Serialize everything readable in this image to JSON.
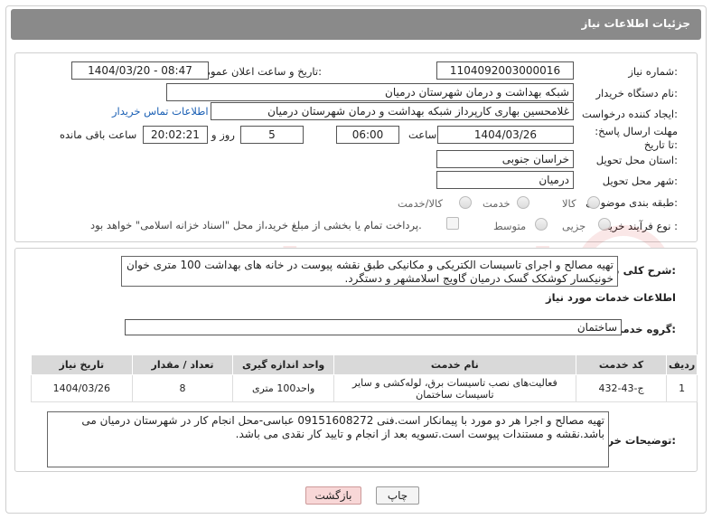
{
  "header": {
    "title": "جزئیات اطلاعات نیاز"
  },
  "form": {
    "need_number_label": "شماره نیاز:",
    "need_number": "1104092003000016",
    "announce_label": "تاریخ و ساعت اعلان عمومی:",
    "announce_value": "1404/03/20 - 08:47",
    "buyer_org_label": "نام دستگاه خریدار:",
    "buyer_org": "شبکه بهداشت و درمان شهرستان درمیان",
    "creator_label": "ایجاد کننده درخواست:",
    "creator": "غلامحسین بهاری کارپرداز شبکه بهداشت و درمان شهرستان درمیان",
    "contact_link": "اطلاعات تماس خریدار",
    "deadline_label": "مهلت ارسال پاسخ: تا تاریخ:",
    "deadline_date": "1404/03/26",
    "time_label": "ساعت",
    "deadline_time": "06:00",
    "days_value": "5",
    "days_label": "روز و",
    "remaining_time": "20:02:21",
    "remaining_label": "ساعت باقی مانده",
    "province_label": "استان محل تحویل:",
    "province": "خراسان جنوبی",
    "city_label": "شهر محل تحویل:",
    "city": "درمیان",
    "category_label": "طبقه بندی موضوعی:",
    "category_options": [
      "کالا",
      "خدمت",
      "کالا/خدمت"
    ],
    "process_label": "نوع فرآیند خرید :",
    "process_options": [
      "جزیی",
      "متوسط"
    ],
    "payment_note": "پرداخت تمام یا بخشی از مبلغ خرید،از محل \"اسناد خزانه اسلامی\" خواهد بود."
  },
  "description": {
    "label": "شرح کلی نیاز:",
    "text": "تهیه مصالح و اجرای تاسیسات الکتریکی و مکانیکی طبق نقشه پیوست در خانه های بهداشت 100 متری خوان خونیکسار کوشکک گسک درمیان گاویج اسلامشهر و دستگرد."
  },
  "services": {
    "section_title": "اطلاعات خدمات مورد نیاز",
    "group_label": "گروه خدمت:",
    "group_value": "ساختمان",
    "columns": [
      "ردیف",
      "کد خدمت",
      "نام خدمت",
      "واحد اندازه گیری",
      "تعداد / مقدار",
      "تاریخ نیاز"
    ],
    "rows": [
      {
        "row": "1",
        "code": "ج-43-432",
        "name": "فعالیت‌های نصب تاسیسات برق، لوله‌کشی و سایر تاسیسات ساختمان",
        "unit": "واحد100 متری",
        "qty": "8",
        "date": "1404/03/26"
      }
    ]
  },
  "buyer_notes": {
    "label": "توضیحات خریدار:",
    "text": "تهیه مصالح و اجرا هر دو مورد با پیمانکار است.فنی 09151608272 عباسی-محل انجام کار در شهرستان درمیان می باشد.نقشه و مستندات پیوست است.تسویه بعد از انجام و تایید کار نقدی می باشد."
  },
  "buttons": {
    "print": "چاپ",
    "back": "بازگشت"
  },
  "colors": {
    "title_bar": "#8a8a8a",
    "link": "#1a5fb4",
    "back_button": "#f8d7d7"
  }
}
